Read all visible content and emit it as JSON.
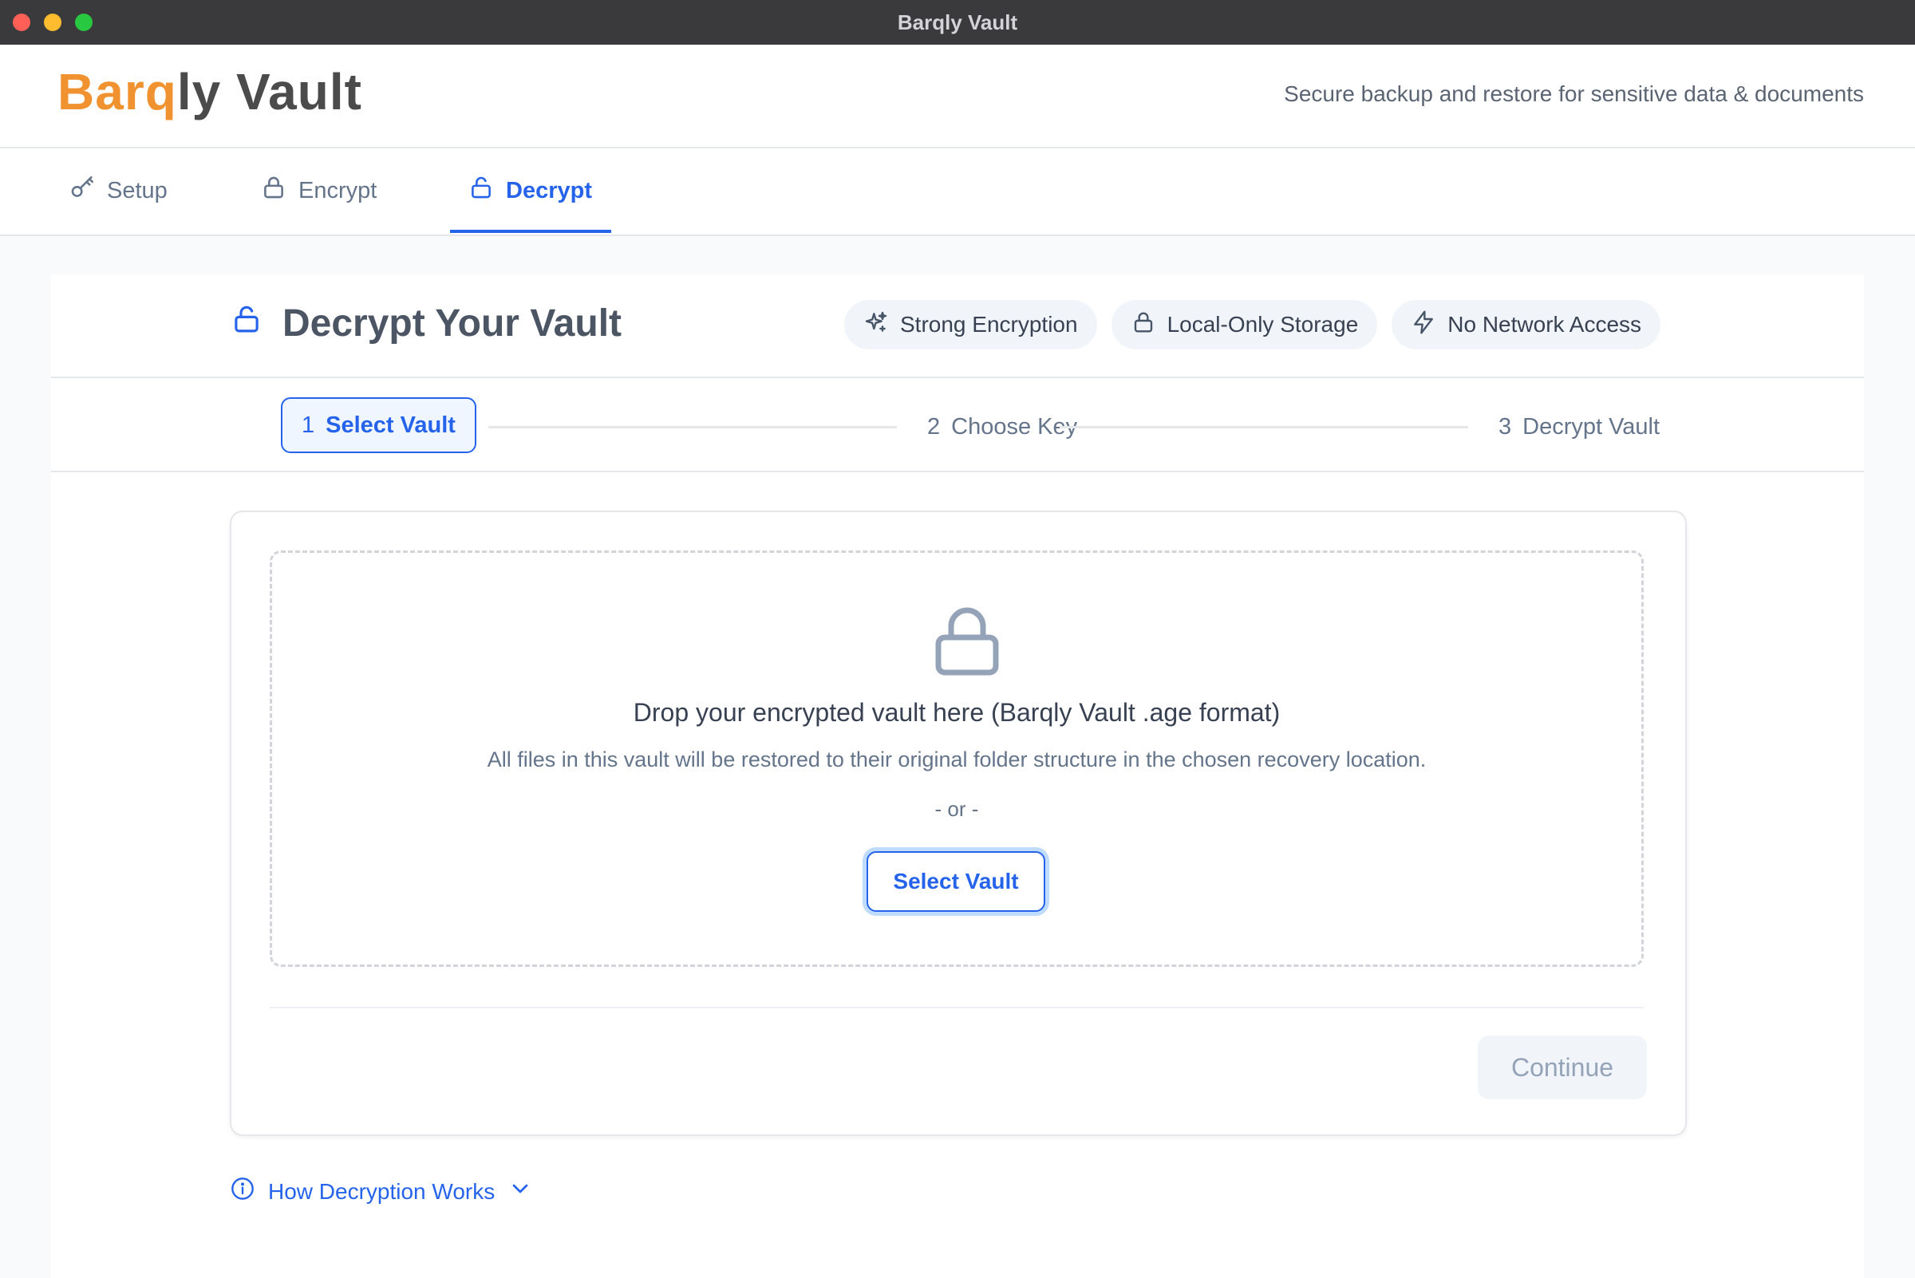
{
  "window": {
    "title": "Barqly Vault"
  },
  "header": {
    "logo_accent": "Barq",
    "logo_rest": "ly Vault",
    "tagline": "Secure backup and restore for sensitive data & documents"
  },
  "tabs": [
    {
      "label": "Setup",
      "icon": "key-icon",
      "active": false
    },
    {
      "label": "Encrypt",
      "icon": "lock-icon",
      "active": false
    },
    {
      "label": "Decrypt",
      "icon": "unlock-icon",
      "active": true
    }
  ],
  "page": {
    "title": "Decrypt Your Vault",
    "badges": [
      {
        "label": "Strong Encryption",
        "icon": "sparkles-icon"
      },
      {
        "label": "Local-Only Storage",
        "icon": "lock-icon"
      },
      {
        "label": "No Network Access",
        "icon": "zap-icon"
      }
    ]
  },
  "steps": [
    {
      "number": "1",
      "label": "Select Vault",
      "active": true
    },
    {
      "number": "2",
      "label": "Choose Key",
      "active": false
    },
    {
      "number": "3",
      "label": "Decrypt Vault",
      "active": false
    }
  ],
  "dropzone": {
    "title": "Drop your encrypted vault here (Barqly Vault .age format)",
    "subtitle": "All files in this vault will be restored to their original folder structure in the chosen recovery location.",
    "or_text": "- or -",
    "button_label": "Select Vault"
  },
  "footer": {
    "continue_label": "Continue",
    "continue_enabled": false
  },
  "help": {
    "label": "How Decryption Works"
  },
  "colors": {
    "accent": "#2563eb",
    "brand_orange": "#f0922f",
    "titlebar": "#3a3a3c"
  }
}
